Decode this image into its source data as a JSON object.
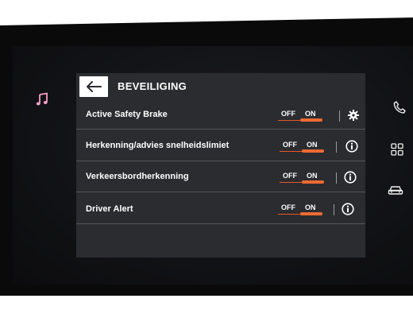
{
  "header": {
    "title": "BEVEILIGING",
    "back_icon": "arrow-left-icon"
  },
  "settings": [
    {
      "label": "Active Safety Brake",
      "off_label": "OFF",
      "on_label": "ON",
      "state": "on",
      "action_icon": "gear-icon"
    },
    {
      "label": "Herkenning/advies snelheidslimiet",
      "off_label": "OFF",
      "on_label": "ON",
      "state": "on",
      "action_icon": "info-icon"
    },
    {
      "label": "Verkeersbordherkenning",
      "off_label": "OFF",
      "on_label": "ON",
      "state": "on",
      "action_icon": "info-icon"
    },
    {
      "label": "Driver Alert",
      "off_label": "OFF",
      "on_label": "ON",
      "state": "on",
      "action_icon": "info-icon"
    }
  ],
  "left_rail": {
    "icons": [
      "music-icon"
    ]
  },
  "right_rail": {
    "icons": [
      "phone-icon",
      "apps-grid-icon",
      "car-icon"
    ]
  },
  "colors": {
    "accent": "#ef6a32",
    "panel": "#2b2c30",
    "text": "#ffffff"
  }
}
